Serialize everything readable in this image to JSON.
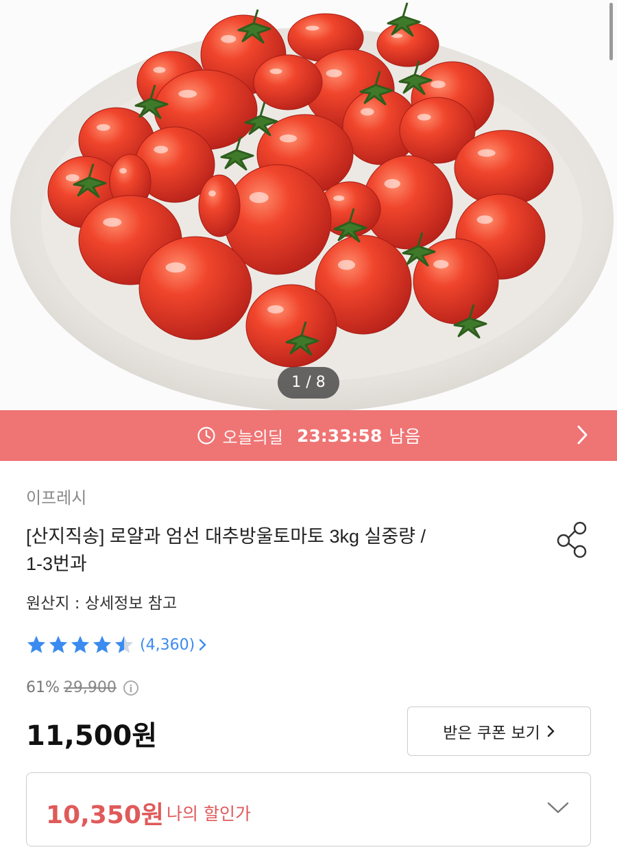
{
  "gallery": {
    "counter": "1 / 8"
  },
  "deal": {
    "icon": "clock-icon",
    "label": "오늘의딜",
    "time": "23:33:58",
    "remaining": "남음"
  },
  "product": {
    "seller": "이프레시",
    "title_line1": "[산지직송] 로얄과 엄선 대추방울토마토 3kg 실중량 /",
    "title_line2": "1-3번과",
    "origin": "원산지 : 상세정보 참고"
  },
  "rating": {
    "stars": 4.5,
    "count": "(4,360)"
  },
  "pricing": {
    "discount_rate": "61%",
    "original_price": "29,900",
    "price": "11,500원",
    "coupon_button": "받은 쿠폰 보기",
    "my_price": "10,350원",
    "my_price_label": "나의 할인가"
  },
  "colors": {
    "deal_bar": "#ef7474",
    "accent_red": "#e05a5a",
    "star_blue": "#3b8bf0"
  }
}
